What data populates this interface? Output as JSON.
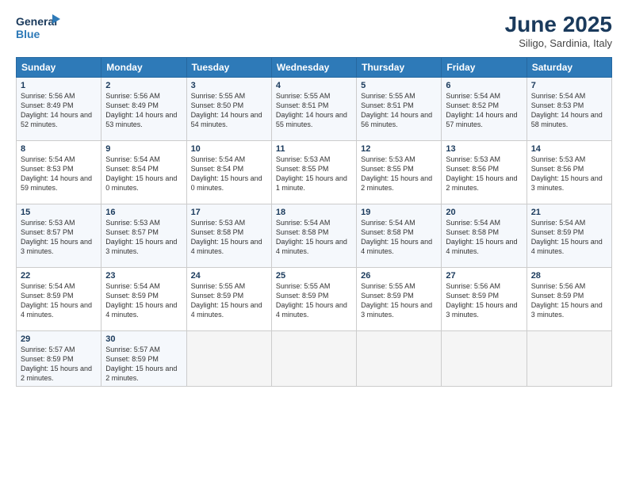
{
  "header": {
    "logo_line1": "General",
    "logo_line2": "Blue",
    "month": "June 2025",
    "location": "Siligo, Sardinia, Italy"
  },
  "weekdays": [
    "Sunday",
    "Monday",
    "Tuesday",
    "Wednesday",
    "Thursday",
    "Friday",
    "Saturday"
  ],
  "weeks": [
    [
      {
        "day": "1",
        "sunrise": "5:56 AM",
        "sunset": "8:49 PM",
        "daylight": "14 hours and 52 minutes."
      },
      {
        "day": "2",
        "sunrise": "5:56 AM",
        "sunset": "8:49 PM",
        "daylight": "14 hours and 53 minutes."
      },
      {
        "day": "3",
        "sunrise": "5:55 AM",
        "sunset": "8:50 PM",
        "daylight": "14 hours and 54 minutes."
      },
      {
        "day": "4",
        "sunrise": "5:55 AM",
        "sunset": "8:51 PM",
        "daylight": "14 hours and 55 minutes."
      },
      {
        "day": "5",
        "sunrise": "5:55 AM",
        "sunset": "8:51 PM",
        "daylight": "14 hours and 56 minutes."
      },
      {
        "day": "6",
        "sunrise": "5:54 AM",
        "sunset": "8:52 PM",
        "daylight": "14 hours and 57 minutes."
      },
      {
        "day": "7",
        "sunrise": "5:54 AM",
        "sunset": "8:53 PM",
        "daylight": "14 hours and 58 minutes."
      }
    ],
    [
      {
        "day": "8",
        "sunrise": "5:54 AM",
        "sunset": "8:53 PM",
        "daylight": "14 hours and 59 minutes."
      },
      {
        "day": "9",
        "sunrise": "5:54 AM",
        "sunset": "8:54 PM",
        "daylight": "15 hours and 0 minutes."
      },
      {
        "day": "10",
        "sunrise": "5:54 AM",
        "sunset": "8:54 PM",
        "daylight": "15 hours and 0 minutes."
      },
      {
        "day": "11",
        "sunrise": "5:53 AM",
        "sunset": "8:55 PM",
        "daylight": "15 hours and 1 minute."
      },
      {
        "day": "12",
        "sunrise": "5:53 AM",
        "sunset": "8:55 PM",
        "daylight": "15 hours and 2 minutes."
      },
      {
        "day": "13",
        "sunrise": "5:53 AM",
        "sunset": "8:56 PM",
        "daylight": "15 hours and 2 minutes."
      },
      {
        "day": "14",
        "sunrise": "5:53 AM",
        "sunset": "8:56 PM",
        "daylight": "15 hours and 3 minutes."
      }
    ],
    [
      {
        "day": "15",
        "sunrise": "5:53 AM",
        "sunset": "8:57 PM",
        "daylight": "15 hours and 3 minutes."
      },
      {
        "day": "16",
        "sunrise": "5:53 AM",
        "sunset": "8:57 PM",
        "daylight": "15 hours and 3 minutes."
      },
      {
        "day": "17",
        "sunrise": "5:53 AM",
        "sunset": "8:58 PM",
        "daylight": "15 hours and 4 minutes."
      },
      {
        "day": "18",
        "sunrise": "5:54 AM",
        "sunset": "8:58 PM",
        "daylight": "15 hours and 4 minutes."
      },
      {
        "day": "19",
        "sunrise": "5:54 AM",
        "sunset": "8:58 PM",
        "daylight": "15 hours and 4 minutes."
      },
      {
        "day": "20",
        "sunrise": "5:54 AM",
        "sunset": "8:58 PM",
        "daylight": "15 hours and 4 minutes."
      },
      {
        "day": "21",
        "sunrise": "5:54 AM",
        "sunset": "8:59 PM",
        "daylight": "15 hours and 4 minutes."
      }
    ],
    [
      {
        "day": "22",
        "sunrise": "5:54 AM",
        "sunset": "8:59 PM",
        "daylight": "15 hours and 4 minutes."
      },
      {
        "day": "23",
        "sunrise": "5:54 AM",
        "sunset": "8:59 PM",
        "daylight": "15 hours and 4 minutes."
      },
      {
        "day": "24",
        "sunrise": "5:55 AM",
        "sunset": "8:59 PM",
        "daylight": "15 hours and 4 minutes."
      },
      {
        "day": "25",
        "sunrise": "5:55 AM",
        "sunset": "8:59 PM",
        "daylight": "15 hours and 4 minutes."
      },
      {
        "day": "26",
        "sunrise": "5:55 AM",
        "sunset": "8:59 PM",
        "daylight": "15 hours and 3 minutes."
      },
      {
        "day": "27",
        "sunrise": "5:56 AM",
        "sunset": "8:59 PM",
        "daylight": "15 hours and 3 minutes."
      },
      {
        "day": "28",
        "sunrise": "5:56 AM",
        "sunset": "8:59 PM",
        "daylight": "15 hours and 3 minutes."
      }
    ],
    [
      {
        "day": "29",
        "sunrise": "5:57 AM",
        "sunset": "8:59 PM",
        "daylight": "15 hours and 2 minutes."
      },
      {
        "day": "30",
        "sunrise": "5:57 AM",
        "sunset": "8:59 PM",
        "daylight": "15 hours and 2 minutes."
      },
      null,
      null,
      null,
      null,
      null
    ]
  ]
}
